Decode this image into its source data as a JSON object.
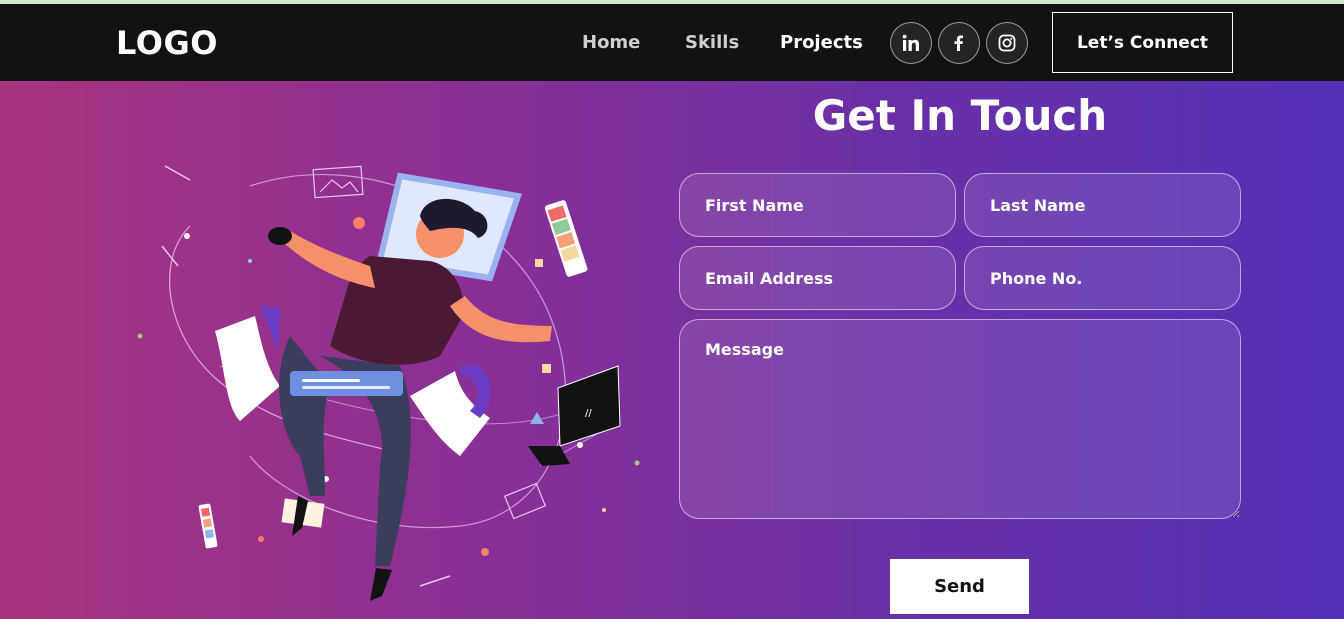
{
  "navbar": {
    "logo": "LOGO",
    "links": [
      {
        "label": "Home"
      },
      {
        "label": "Skills"
      },
      {
        "label": "Projects"
      }
    ],
    "social": [
      "linkedin-icon",
      "facebook-icon",
      "instagram-icon"
    ],
    "connect_label": "Let’s Connect"
  },
  "contact": {
    "title": "Get In Touch",
    "fields": {
      "first_name": "First Name",
      "last_name": "Last Name",
      "email": "Email Address",
      "phone": "Phone No.",
      "message": "Message"
    },
    "send_label": "Send"
  },
  "colors": {
    "navbar_bg": "#121212",
    "gradient_start": "#a8347f",
    "gradient_end": "#5330b6"
  }
}
